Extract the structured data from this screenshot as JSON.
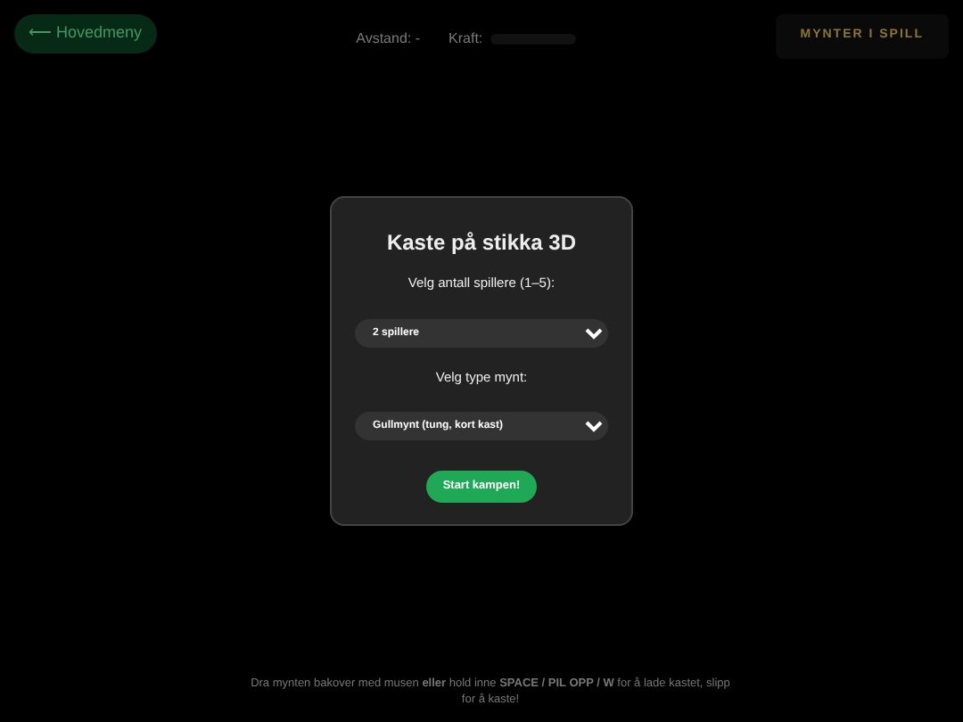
{
  "back_button": {
    "label": "⟵ Hovedmeny"
  },
  "hud": {
    "distance_label": "Avstand:",
    "distance_value": "-",
    "power_label": "Kraft:"
  },
  "coins_panel": {
    "title": "MYNTER I SPILL"
  },
  "instructions": "Dra mynten bakover med musen **eller** hold inne **SPACE / PIL OPP / W** for å lade kastet, slipp for å kaste!",
  "dialog": {
    "title": "Kaste på stikka 3D",
    "fields": [
      {
        "label": "Velg antall spillere (1–5):",
        "value": "2 spillere"
      },
      {
        "label": "Velg type mynt:",
        "value": "Gullmynt (tung, kort kast)"
      }
    ],
    "button": "Start kampen!"
  }
}
